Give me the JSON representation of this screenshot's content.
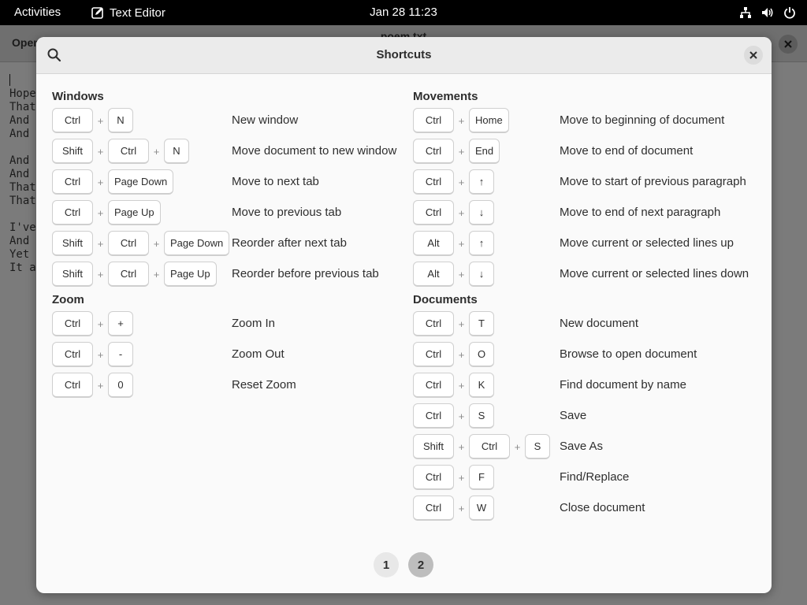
{
  "topbar": {
    "activities": "Activities",
    "app_name": "Text Editor",
    "clock": "Jan 28  11:23",
    "tray_icons": [
      "network-icon",
      "volume-icon",
      "power-icon"
    ]
  },
  "app": {
    "open_label": "Open",
    "file_title": "poem.txt",
    "text_lines": [
      "Hope",
      "That",
      "And ",
      "And ",
      "",
      "And ",
      "And ",
      "That",
      "That",
      "",
      "I've",
      "And ",
      "Yet ",
      "It a"
    ]
  },
  "dialog": {
    "title": "Shortcuts",
    "pages": [
      "1",
      "2"
    ],
    "current_page": "2",
    "left": [
      {
        "title": "Windows",
        "rows": [
          {
            "keys": [
              "Ctrl",
              "N"
            ],
            "desc": "New window"
          },
          {
            "keys": [
              "Shift",
              "Ctrl",
              "N"
            ],
            "desc": "Move document to new window"
          },
          {
            "keys": [
              "Ctrl",
              "Page Down"
            ],
            "desc": "Move to next tab"
          },
          {
            "keys": [
              "Ctrl",
              "Page Up"
            ],
            "desc": "Move to previous tab"
          },
          {
            "keys": [
              "Shift",
              "Ctrl",
              "Page Down"
            ],
            "desc": "Reorder after next tab"
          },
          {
            "keys": [
              "Shift",
              "Ctrl",
              "Page Up"
            ],
            "desc": "Reorder before previous tab"
          }
        ]
      },
      {
        "title": "Zoom",
        "rows": [
          {
            "keys": [
              "Ctrl",
              "+"
            ],
            "desc": "Zoom In"
          },
          {
            "keys": [
              "Ctrl",
              "-"
            ],
            "desc": "Zoom Out"
          },
          {
            "keys": [
              "Ctrl",
              "0"
            ],
            "desc": "Reset Zoom"
          }
        ]
      }
    ],
    "right": [
      {
        "title": "Movements",
        "rows": [
          {
            "keys": [
              "Ctrl",
              "Home"
            ],
            "desc": "Move to beginning of document"
          },
          {
            "keys": [
              "Ctrl",
              "End"
            ],
            "desc": "Move to end of document"
          },
          {
            "keys": [
              "Ctrl",
              "↑"
            ],
            "desc": "Move to start of previous paragraph"
          },
          {
            "keys": [
              "Ctrl",
              "↓"
            ],
            "desc": "Move to end of next paragraph"
          },
          {
            "keys": [
              "Alt",
              "↑"
            ],
            "desc": "Move current or selected lines up"
          },
          {
            "keys": [
              "Alt",
              "↓"
            ],
            "desc": "Move current or selected lines down"
          }
        ]
      },
      {
        "title": "Documents",
        "rows": [
          {
            "keys": [
              "Ctrl",
              "T"
            ],
            "desc": "New document"
          },
          {
            "keys": [
              "Ctrl",
              "O"
            ],
            "desc": "Browse to open document"
          },
          {
            "keys": [
              "Ctrl",
              "K"
            ],
            "desc": "Find document by name"
          },
          {
            "keys": [
              "Ctrl",
              "S"
            ],
            "desc": "Save"
          },
          {
            "keys": [
              "Shift",
              "Ctrl",
              "S"
            ],
            "desc": "Save As"
          },
          {
            "keys": [
              "Ctrl",
              "F"
            ],
            "desc": "Find/Replace"
          },
          {
            "keys": [
              "Ctrl",
              "W"
            ],
            "desc": "Close document"
          }
        ]
      }
    ]
  }
}
